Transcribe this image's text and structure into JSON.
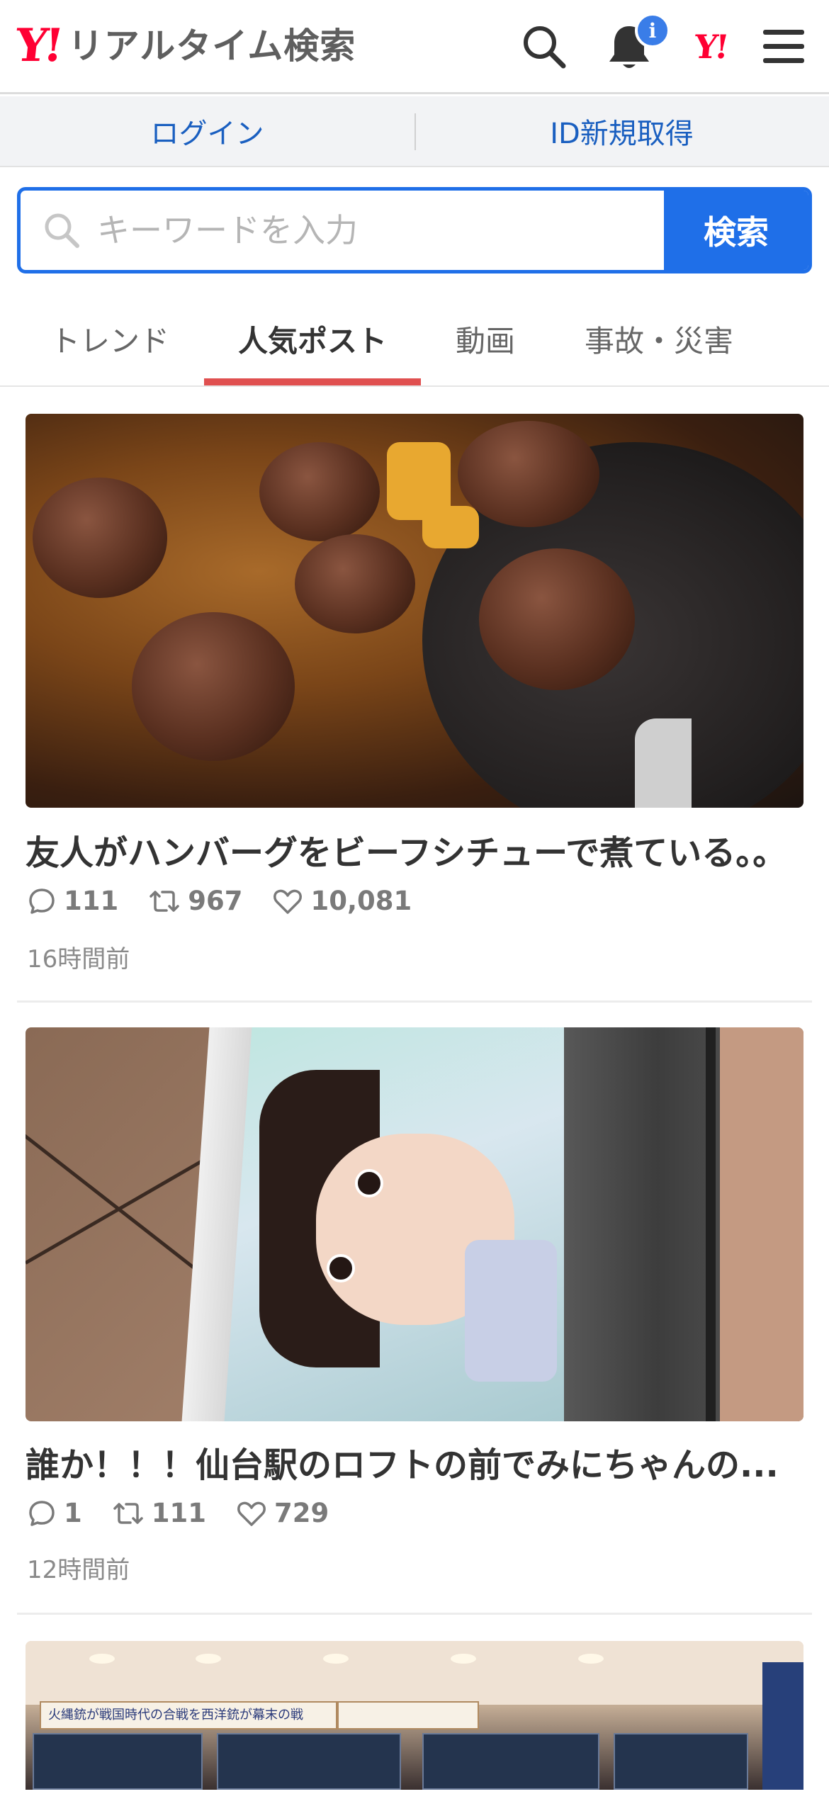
{
  "header": {
    "logo_mark": "Y!",
    "logo_text": "リアルタイム検索",
    "notification_badge": "i",
    "yj_mark": "Y!"
  },
  "auth": {
    "login_label": "ログイン",
    "signup_label": "ID新規取得"
  },
  "search": {
    "placeholder": "キーワードを入力",
    "button_label": "検索"
  },
  "tabs": [
    {
      "label": "トレンド",
      "active": false
    },
    {
      "label": "人気ポスト",
      "active": true
    },
    {
      "label": "動画",
      "active": false
    },
    {
      "label": "事故・災害",
      "active": false
    }
  ],
  "posts": [
    {
      "title": "友人がハンバーグをビーフシチューで煮ている。。",
      "replies": "111",
      "reposts": "967",
      "likes": "10,081",
      "time": "16時間前"
    },
    {
      "title": "誰か！！！仙台駅のロフトの前でみにちゃんの...",
      "replies": "1",
      "reposts": "111",
      "likes": "729",
      "time": "12時間前"
    },
    {
      "image_caption": "火縄銃が戦国時代の合戦を西洋銃が幕末の戦"
    }
  ],
  "colors": {
    "brand_red": "#ff0033",
    "accent_blue": "#1f6fe8",
    "tab_underline": "#e05050"
  }
}
